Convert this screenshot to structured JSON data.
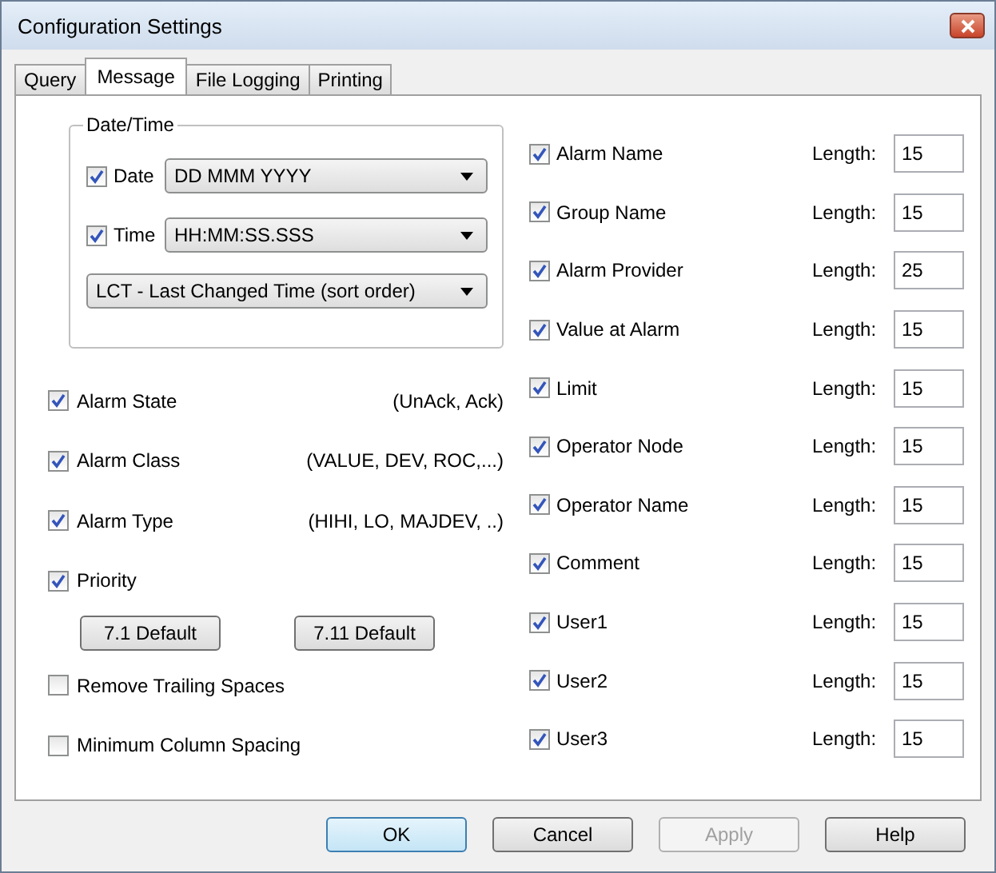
{
  "window": {
    "title": "Configuration Settings"
  },
  "tabs": [
    {
      "label": "Query",
      "selected": false
    },
    {
      "label": "Message",
      "selected": true
    },
    {
      "label": "File Logging",
      "selected": false
    },
    {
      "label": "Printing",
      "selected": false
    }
  ],
  "date_time": {
    "legend": "Date/Time",
    "rows": [
      {
        "label": "Date",
        "checked": true,
        "value": "DD MMM YYYY"
      },
      {
        "label": "Time",
        "checked": true,
        "value": "HH:MM:SS.SSS"
      }
    ],
    "sort_order": "LCT - Last Changed Time (sort order)"
  },
  "left_options": [
    {
      "kind": "check",
      "label": "Alarm State",
      "checked": true,
      "detail": "(UnAck, Ack)"
    },
    {
      "kind": "check",
      "label": "Alarm Class",
      "checked": true,
      "detail": "(VALUE, DEV, ROC,...)"
    },
    {
      "kind": "check",
      "label": "Alarm Type",
      "checked": true,
      "detail": "(HIHI, LO, MAJDEV, ..)"
    },
    {
      "kind": "check",
      "label": "Priority",
      "checked": true
    },
    {
      "kind": "buttons",
      "buttons": [
        "7.1 Default",
        "7.11 Default"
      ]
    },
    {
      "kind": "check",
      "label": "Remove Trailing Spaces",
      "checked": false
    },
    {
      "kind": "check",
      "label": "Minimum Column Spacing",
      "checked": false
    }
  ],
  "fields": [
    {
      "label": "Alarm Name",
      "checked": true,
      "length_label": "Length:",
      "value": "15"
    },
    {
      "label": "Group Name",
      "checked": true,
      "length_label": "Length:",
      "value": "15"
    },
    {
      "label": "Alarm Provider",
      "checked": true,
      "length_label": "Length:",
      "value": "25"
    },
    {
      "label": "Value at Alarm",
      "checked": true,
      "length_label": "Length:",
      "value": "15"
    },
    {
      "label": "Limit",
      "checked": true,
      "length_label": "Length:",
      "value": "15"
    },
    {
      "label": "Operator Node",
      "checked": true,
      "length_label": "Length:",
      "value": "15"
    },
    {
      "label": "Operator Name",
      "checked": true,
      "length_label": "Length:",
      "value": "15"
    },
    {
      "label": "Comment",
      "checked": true,
      "length_label": "Length:",
      "value": "15"
    },
    {
      "label": "User1",
      "checked": true,
      "length_label": "Length:",
      "value": "15"
    },
    {
      "label": "User2",
      "checked": true,
      "length_label": "Length:",
      "value": "15"
    },
    {
      "label": "User3",
      "checked": true,
      "length_label": "Length:",
      "value": "15"
    }
  ],
  "buttons": [
    {
      "label": "OK",
      "default": true,
      "disabled": false
    },
    {
      "label": "Cancel",
      "default": false,
      "disabled": false
    },
    {
      "label": "Apply",
      "default": false,
      "disabled": true
    },
    {
      "label": "Help",
      "default": false,
      "disabled": false
    }
  ]
}
